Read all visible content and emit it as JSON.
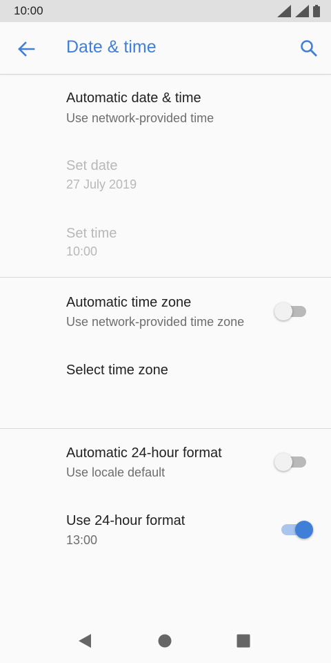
{
  "status_bar": {
    "time": "10:00"
  },
  "app_bar": {
    "title": "Date & time",
    "back_icon": "arrow-back-icon",
    "search_icon": "search-icon"
  },
  "colors": {
    "accent": "#3f7fd7",
    "status_bar_bg": "#e0e0e0",
    "background": "#fafafa",
    "primary_text": "#212121",
    "secondary_text": "#6d6d6d",
    "disabled_text": "#b8b8b8"
  },
  "settings": {
    "automatic_date_time": {
      "title": "Automatic date & time",
      "summary": "Use network-provided time"
    },
    "set_date": {
      "title": "Set date",
      "summary": "27 July 2019",
      "enabled": false
    },
    "set_time": {
      "title": "Set time",
      "summary": "10:00",
      "enabled": false
    },
    "automatic_time_zone": {
      "title": "Automatic time zone",
      "summary": "Use network-provided time zone",
      "switch_on": false
    },
    "select_time_zone": {
      "title": "Select time zone"
    },
    "automatic_24_hour": {
      "title": "Automatic 24-hour format",
      "summary": "Use locale default",
      "switch_on": false
    },
    "use_24_hour": {
      "title": "Use 24-hour format",
      "summary": "13:00",
      "switch_on": true
    }
  },
  "nav_bar": {
    "back_icon": "nav-back-triangle-icon",
    "home_icon": "nav-home-circle-icon",
    "recents_icon": "nav-recents-square-icon"
  }
}
